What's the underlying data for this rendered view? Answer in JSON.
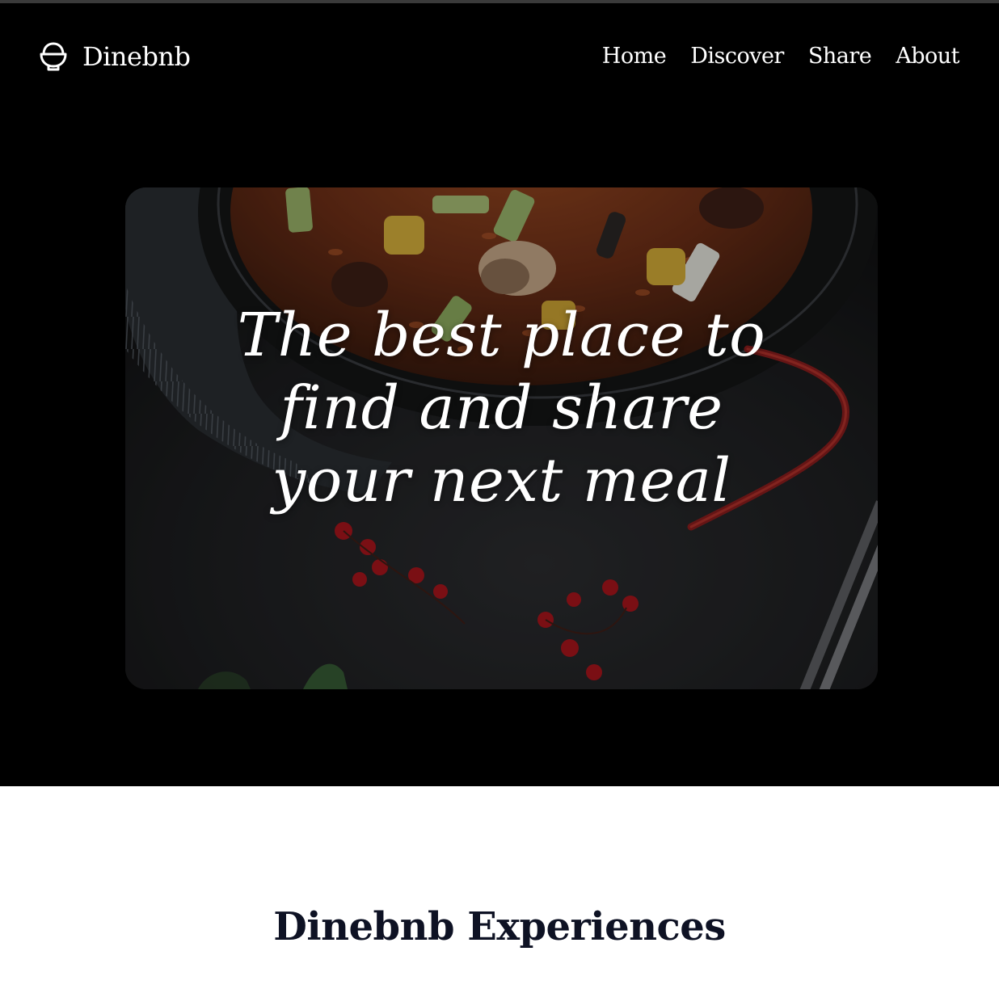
{
  "header": {
    "brand_name": "Dinebnb",
    "brand_icon": "rice-bowl-icon",
    "nav": [
      {
        "label": "Home"
      },
      {
        "label": "Discover"
      },
      {
        "label": "Share"
      },
      {
        "label": "About"
      }
    ]
  },
  "hero": {
    "heading": "The best place to find and share your next meal",
    "image": "paella-pan-photo"
  },
  "experiences": {
    "title": "Dinebnb Experiences"
  },
  "colors": {
    "hero_background": "#000000",
    "page_background": "#ffffff",
    "heading_text": "#0e1224",
    "nav_text": "#ffffff"
  }
}
